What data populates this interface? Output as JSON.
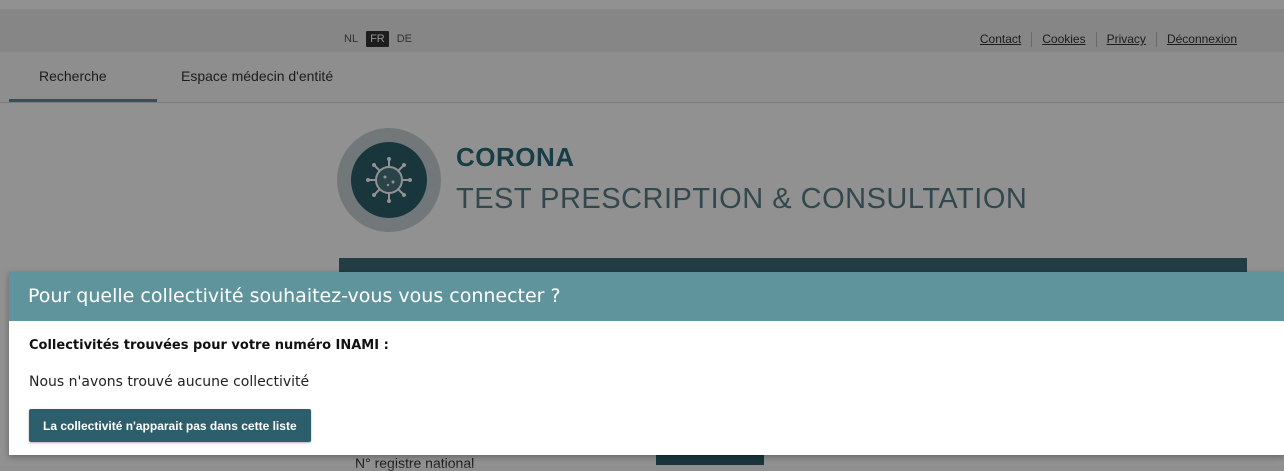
{
  "topbar": {
    "languages": [
      {
        "code": "NL",
        "active": false
      },
      {
        "code": "FR",
        "active": true
      },
      {
        "code": "DE",
        "active": false
      }
    ],
    "links": [
      "Contact",
      "Cookies",
      "Privacy",
      "Déconnexion"
    ]
  },
  "nav": {
    "tabs": [
      {
        "label": "Recherche",
        "active": true
      },
      {
        "label": "Espace médecin d'entité",
        "active": false
      }
    ]
  },
  "header": {
    "title_line1": "CORONA",
    "title_line2": "TEST PRESCRIPTION & CONSULTATION",
    "logo_icon": "virus-icon"
  },
  "background_form": {
    "input_label": "N° registre national"
  },
  "modal": {
    "title": "Pour quelle collectivité souhaitez-vous vous connecter ?",
    "found_label": "Collectivités trouvées pour votre numéro INAMI :",
    "none_found": "Nous n'avons trouvé aucune collectivité",
    "button_label": "La collectivité n'apparait pas dans cette liste"
  },
  "colors": {
    "accent": "#2c5f6b",
    "modal_header": "#5f949c",
    "title": "#2c6b78"
  }
}
